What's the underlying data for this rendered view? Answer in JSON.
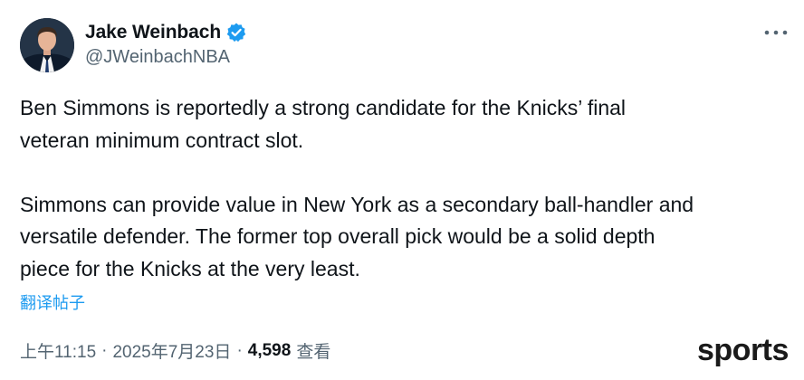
{
  "author": {
    "display_name": "Jake Weinbach",
    "handle": "@JWeinbachNBA",
    "verified": true,
    "avatar_icon": "profile-photo",
    "verified_icon": "verified-badge-icon"
  },
  "menu": {
    "icon": "more-options-icon"
  },
  "tweet": {
    "paragraphs": [
      "Ben Simmons is reportedly a strong candidate for the Knicks’ final\nveteran minimum contract slot.",
      "Simmons can provide value in New York as a secondary ball-handler and\nversatile defender. The former top overall pick would be a solid depth\npiece for the Knicks at the very least."
    ],
    "translate_label": "翻译帖子"
  },
  "meta": {
    "time": "上午11:15",
    "separator": "·",
    "date": "2025年7月23日",
    "views_count": "4,598",
    "views_label": "查看"
  },
  "watermark": {
    "text": "sports"
  },
  "colors": {
    "text_primary": "#0f1419",
    "text_secondary": "#536471",
    "link": "#1d9bf0",
    "verified": "#1d9bf0",
    "background": "#ffffff"
  }
}
